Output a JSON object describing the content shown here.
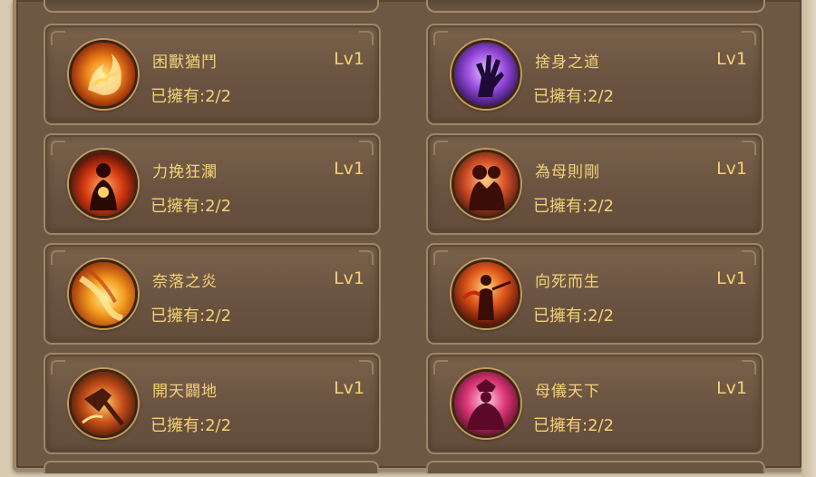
{
  "skills": [
    {
      "name": "困獸猶鬥",
      "level": "Lv1",
      "owned": "已擁有:2/2",
      "icon": "fire-beast-icon"
    },
    {
      "name": "捨身之道",
      "level": "Lv1",
      "owned": "已擁有:2/2",
      "icon": "purple-hand-icon"
    },
    {
      "name": "力挽狂瀾",
      "level": "Lv1",
      "owned": "已擁有:2/2",
      "icon": "flaming-warrior-icon"
    },
    {
      "name": "為母則剛",
      "level": "Lv1",
      "owned": "已擁有:2/2",
      "icon": "mother-child-icon"
    },
    {
      "name": "奈落之炎",
      "level": "Lv1",
      "owned": "已擁有:2/2",
      "icon": "falling-flame-icon"
    },
    {
      "name": "向死而生",
      "level": "Lv1",
      "owned": "已擁有:2/2",
      "icon": "sword-warrior-icon"
    },
    {
      "name": "開天闢地",
      "level": "Lv1",
      "owned": "已擁有:2/2",
      "icon": "axe-strike-icon"
    },
    {
      "name": "母儀天下",
      "level": "Lv1",
      "owned": "已擁有:2/2",
      "icon": "empress-icon"
    }
  ],
  "colors": {
    "text_gold": "#f3d277",
    "card_bg": "#6a5340",
    "card_border": "#9f8566",
    "panel_bg": "#6e5844"
  }
}
